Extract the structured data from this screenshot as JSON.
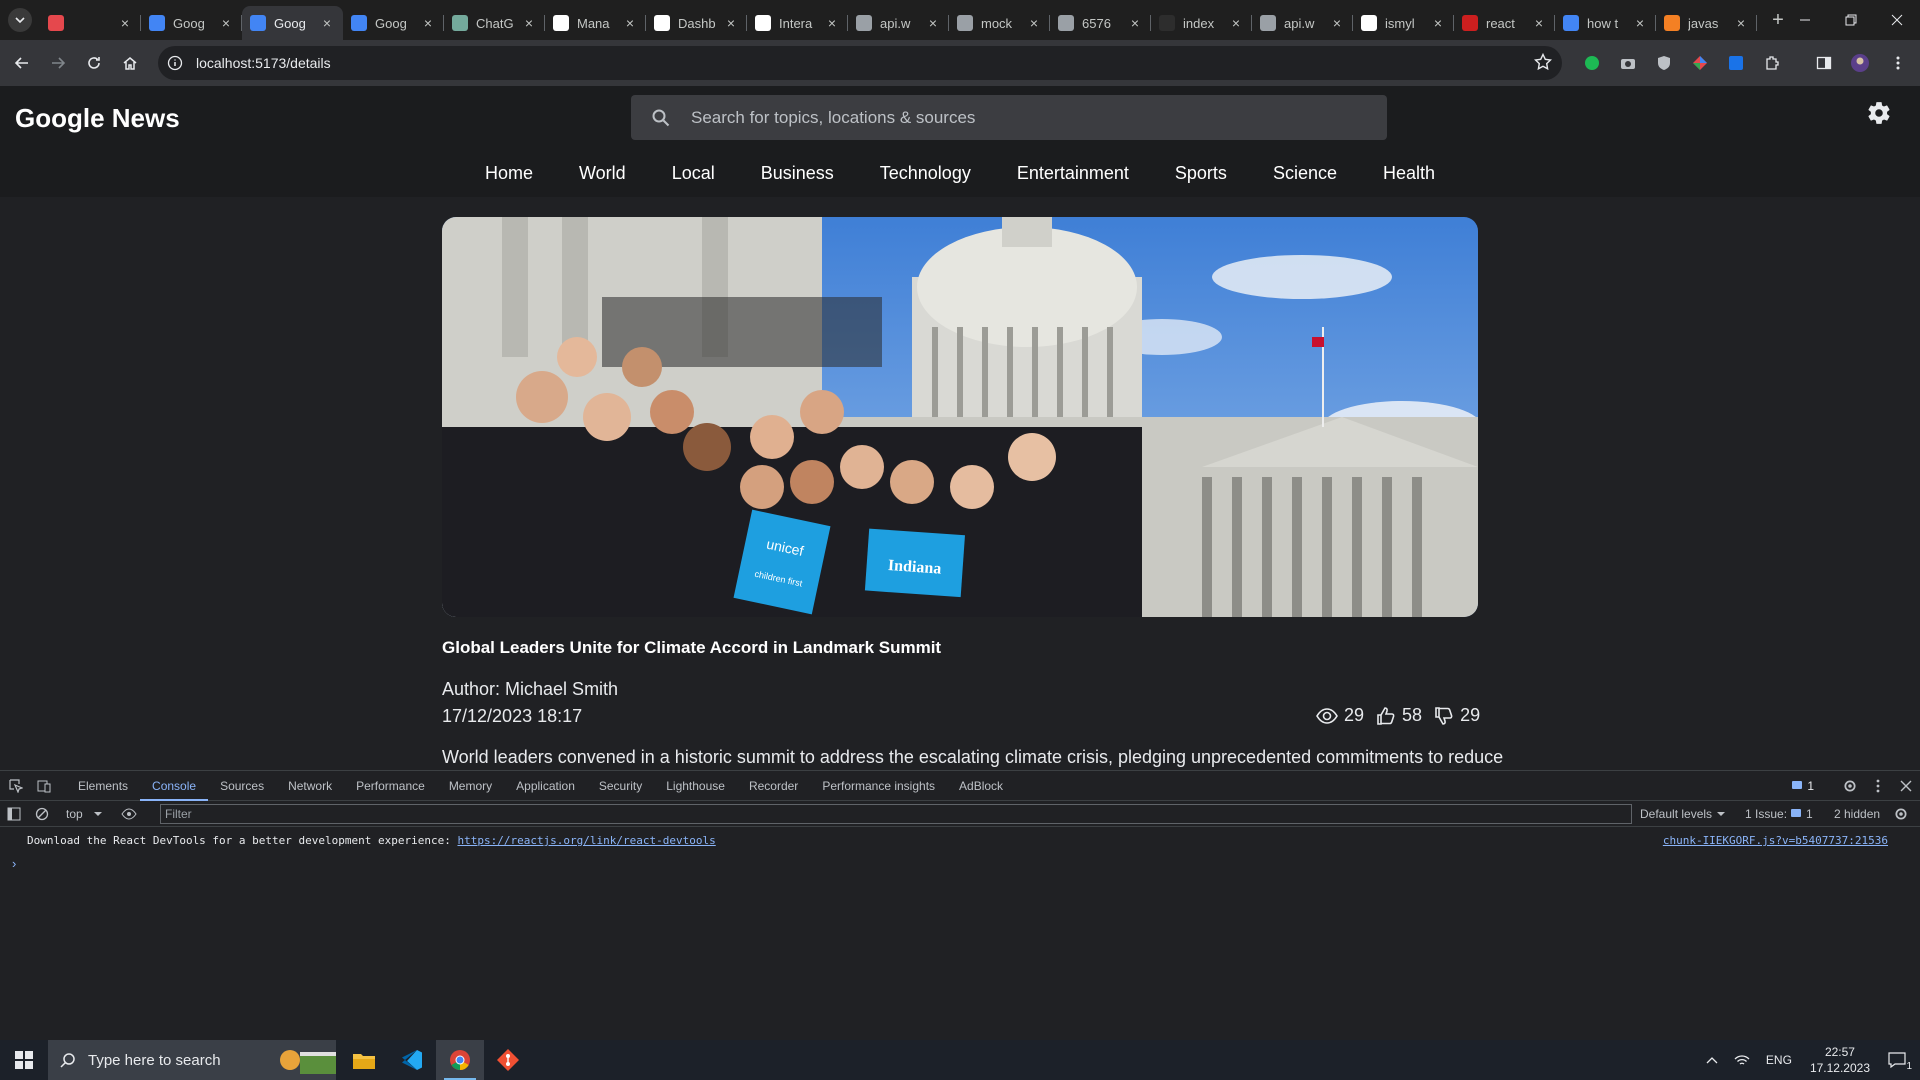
{
  "browser": {
    "tabs": [
      {
        "title": "",
        "favicon_color": "#e5484d",
        "icon": "pen-icon"
      },
      {
        "title": "Goog",
        "favicon_color": "#4285f4",
        "icon": "google-news-icon"
      },
      {
        "title": "Goog",
        "favicon_color": "#4285f4",
        "icon": "google-news-icon",
        "active": true
      },
      {
        "title": "Goog",
        "favicon_color": "#4285f4",
        "icon": "google-news-icon"
      },
      {
        "title": "ChatG",
        "favicon_color": "#74aa9c",
        "icon": "chatgpt-icon"
      },
      {
        "title": "Mana",
        "favicon_color": "#ffffff",
        "icon": "github-icon"
      },
      {
        "title": "Dashb",
        "favicon_color": "#ffffff",
        "icon": "dashboard-icon"
      },
      {
        "title": "Intera",
        "favicon_color": "#ffffff",
        "icon": "doc-icon"
      },
      {
        "title": "api.w",
        "favicon_color": "#9aa0a6",
        "icon": "globe-icon"
      },
      {
        "title": "mock",
        "favicon_color": "#9aa0a6",
        "icon": "api-icon"
      },
      {
        "title": "6576",
        "favicon_color": "#9aa0a6",
        "icon": "api-icon"
      },
      {
        "title": "index",
        "favicon_color": "#2d2d2d",
        "icon": "github-icon"
      },
      {
        "title": "api.w",
        "favicon_color": "#9aa0a6",
        "icon": "globe-icon"
      },
      {
        "title": "ismyl",
        "favicon_color": "#ffffff",
        "icon": "github-icon"
      },
      {
        "title": "react",
        "favicon_color": "#cc1f1f",
        "icon": "npm-icon"
      },
      {
        "title": "how t",
        "favicon_color": "#4285f4",
        "icon": "google-icon"
      },
      {
        "title": "javas",
        "favicon_color": "#f48024",
        "icon": "stackoverflow-icon"
      }
    ],
    "url": "localhost:5173/details"
  },
  "site": {
    "brand": "Google News",
    "search_placeholder": "Search for topics, locations & sources",
    "nav": [
      "Home",
      "World",
      "Local",
      "Business",
      "Technology",
      "Entertainment",
      "Sports",
      "Science",
      "Health"
    ]
  },
  "article": {
    "image_signs": {
      "left": "unicef",
      "left_sub": "children first",
      "right": "Indiana"
    },
    "headline": "Global Leaders Unite for Climate Accord in Landmark Summit",
    "author": "Author: Michael Smith",
    "date": "17/12/2023 18:17",
    "views": "29",
    "likes": "58",
    "dislikes": "29",
    "summary": "World leaders convened in a historic summit to address the escalating climate crisis, pledging unprecedented commitments to reduce"
  },
  "devtools": {
    "tabs": [
      "Elements",
      "Console",
      "Sources",
      "Network",
      "Performance",
      "Memory",
      "Application",
      "Security",
      "Lighthouse",
      "Recorder",
      "Performance insights",
      "AdBlock"
    ],
    "active_tab": "Console",
    "issues_badge": "1",
    "context": "top",
    "filter_placeholder": "Filter",
    "levels": "Default levels",
    "issue_count": "1 Issue:",
    "issue_num": "1",
    "hidden": "2 hidden",
    "message": "Download the React DevTools for a better development experience: ",
    "link": "https://reactjs.org/link/react-devtools",
    "source": "chunk-IIEKGORF.js?v=b5407737:21536"
  },
  "taskbar": {
    "search_placeholder": "Type here to search",
    "language": "ENG",
    "time": "22:57",
    "date": "17.12.2023",
    "notifications": "1"
  }
}
